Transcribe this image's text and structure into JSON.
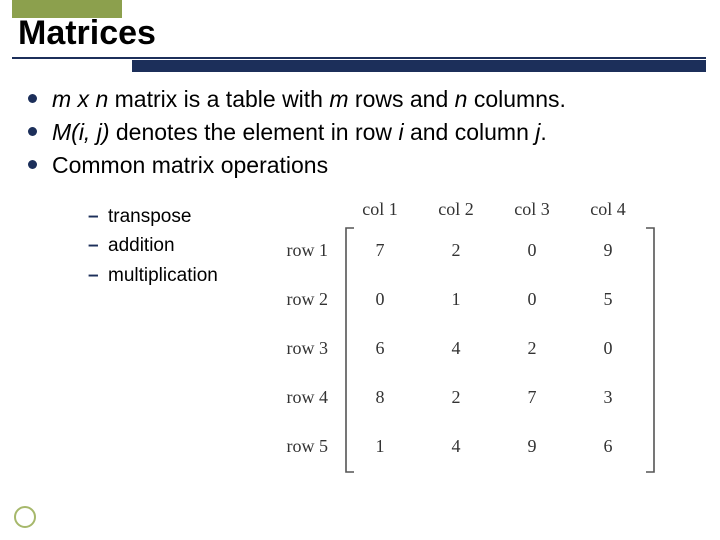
{
  "title": "Matrices",
  "bullets": {
    "b1_pre": "m x n",
    "b1_mid": " matrix is a table with ",
    "b1_m": "m",
    "b1_rows": " rows and ",
    "b1_n": "n",
    "b1_end": " columns.",
    "b2_pre": "M(i, j)",
    "b2_mid": " denotes the element in row ",
    "b2_i": "i",
    "b2_and": " and column ",
    "b2_j": "j",
    "b2_end": ".",
    "b3": "Common matrix operations"
  },
  "subs": {
    "s1": "transpose",
    "s2": "addition",
    "s3": "multiplication"
  },
  "chart_data": {
    "type": "table",
    "col_labels": [
      "col 1",
      "col 2",
      "col 3",
      "col 4"
    ],
    "row_labels": [
      "row 1",
      "row 2",
      "row 3",
      "row 4",
      "row 5"
    ],
    "values": [
      [
        7,
        2,
        0,
        9
      ],
      [
        0,
        1,
        0,
        5
      ],
      [
        6,
        4,
        2,
        0
      ],
      [
        8,
        2,
        7,
        3
      ],
      [
        1,
        4,
        9,
        6
      ]
    ]
  }
}
